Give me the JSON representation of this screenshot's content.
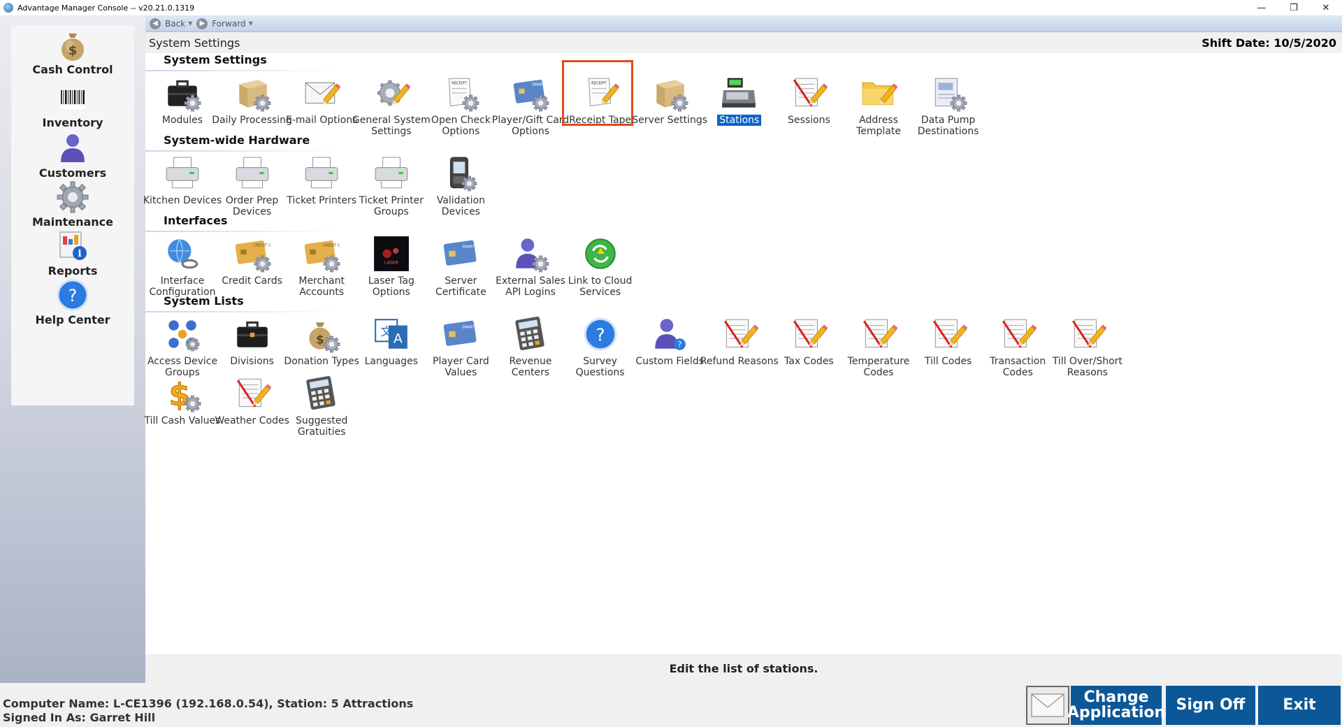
{
  "window": {
    "title": "Advantage Manager Console -- v20.21.0.1319",
    "minimize": "—",
    "restore": "❐",
    "close": "✕"
  },
  "leftnav": {
    "items": [
      {
        "label": "Cash Control",
        "icon": "money-bag-icon"
      },
      {
        "label": "Inventory",
        "icon": "barcode-icon"
      },
      {
        "label": "Customers",
        "icon": "person-icon"
      },
      {
        "label": "Maintenance",
        "icon": "gear-icon"
      },
      {
        "label": "Reports",
        "icon": "report-icon"
      },
      {
        "label": "Help Center",
        "icon": "help-icon"
      }
    ]
  },
  "navbar": {
    "back": "Back",
    "forward": "Forward"
  },
  "header": {
    "title": "System Settings",
    "shift_date": "Shift Date: 10/5/2020"
  },
  "sections": [
    {
      "title": "System Settings",
      "items": [
        {
          "label": "Modules",
          "icon": "briefcase-gear-icon"
        },
        {
          "label": "Daily Processing",
          "icon": "box-gear-icon"
        },
        {
          "label": "E-mail Options",
          "icon": "envelope-pencil-icon"
        },
        {
          "label": "General System Settings",
          "icon": "gear-pencil-icon"
        },
        {
          "label": "Open Check Options",
          "icon": "receipt-gear-icon"
        },
        {
          "label": "Player/Gift Card Options",
          "icon": "smart-card-gear-icon"
        },
        {
          "label": "Receipt Tape",
          "icon": "receipt-pencil-icon"
        },
        {
          "label": "Server Settings",
          "icon": "box-gear-icon"
        },
        {
          "label": "Stations",
          "icon": "cash-register-icon"
        },
        {
          "label": "Sessions",
          "icon": "list-pencil-icon"
        },
        {
          "label": "Address Template",
          "icon": "folder-pencil-icon"
        },
        {
          "label": "Data Pump Destinations",
          "icon": "document-gear-icon"
        }
      ]
    },
    {
      "title": "System-wide Hardware",
      "items": [
        {
          "label": "Kitchen Devices",
          "icon": "printer-icon"
        },
        {
          "label": "Order Prep Devices",
          "icon": "printer-icon"
        },
        {
          "label": "Ticket Printers",
          "icon": "printer-icon"
        },
        {
          "label": "Ticket Printer Groups",
          "icon": "printer-icon"
        },
        {
          "label": "Validation Devices",
          "icon": "handheld-device-icon"
        }
      ]
    },
    {
      "title": "Interfaces",
      "items": [
        {
          "label": "Interface Configuration",
          "icon": "globe-link-icon"
        },
        {
          "label": "Credit Cards",
          "icon": "credit-card-gear-icon"
        },
        {
          "label": "Merchant Accounts",
          "icon": "credit-card-gear-icon"
        },
        {
          "label": "Laser Tag Options",
          "icon": "laser-tag-icon"
        },
        {
          "label": "Server Certificate",
          "icon": "smart-card-icon"
        },
        {
          "label": "External Sales API Logins",
          "icon": "person-gear-icon"
        },
        {
          "label": "Link to Cloud Services",
          "icon": "cloud-sync-icon"
        }
      ]
    },
    {
      "title": "System Lists",
      "items": [
        {
          "label": "Access Device Groups",
          "icon": "device-group-icon"
        },
        {
          "label": "Divisions",
          "icon": "briefcase-icon"
        },
        {
          "label": "Donation Types",
          "icon": "money-bag-gear-icon"
        },
        {
          "label": "Languages",
          "icon": "language-icon"
        },
        {
          "label": "Player Card Values",
          "icon": "smart-card-icon"
        },
        {
          "label": "Revenue Centers",
          "icon": "calculator-icon"
        },
        {
          "label": "Survey Questions",
          "icon": "help-icon"
        },
        {
          "label": "Custom Fields",
          "icon": "person-help-icon"
        },
        {
          "label": "Refund Reasons",
          "icon": "list-pencil-icon"
        },
        {
          "label": "Tax Codes",
          "icon": "list-pencil-icon"
        },
        {
          "label": "Temperature Codes",
          "icon": "list-pencil-icon"
        },
        {
          "label": "Till Codes",
          "icon": "list-pencil-icon"
        },
        {
          "label": "Transaction Codes",
          "icon": "list-pencil-icon"
        },
        {
          "label": "Till Over/Short Reasons",
          "icon": "list-pencil-icon"
        },
        {
          "label": "Till Cash Values",
          "icon": "dollar-gear-icon"
        },
        {
          "label": "Weather Codes",
          "icon": "list-pencil-icon"
        },
        {
          "label": "Suggested Gratuities",
          "icon": "calculator-icon"
        }
      ]
    }
  ],
  "selected_item": "Stations",
  "highlighted_item": "Receipt Tape",
  "status_message": "Edit the list of stations.",
  "footer": {
    "computer_info": "Computer Name: L-CE1396 (192.168.0.54), Station: 5 Attractions",
    "signed_in": "Signed In As: Garret Hill",
    "mail_icon": "envelope-icon",
    "change_line1": "Change",
    "change_line2": "Application",
    "sign_off": "Sign Off",
    "exit": "Exit"
  },
  "colors": {
    "accent": "#0c5797",
    "selection": "#0a64c8",
    "highlight_border": "#e34a1b"
  }
}
